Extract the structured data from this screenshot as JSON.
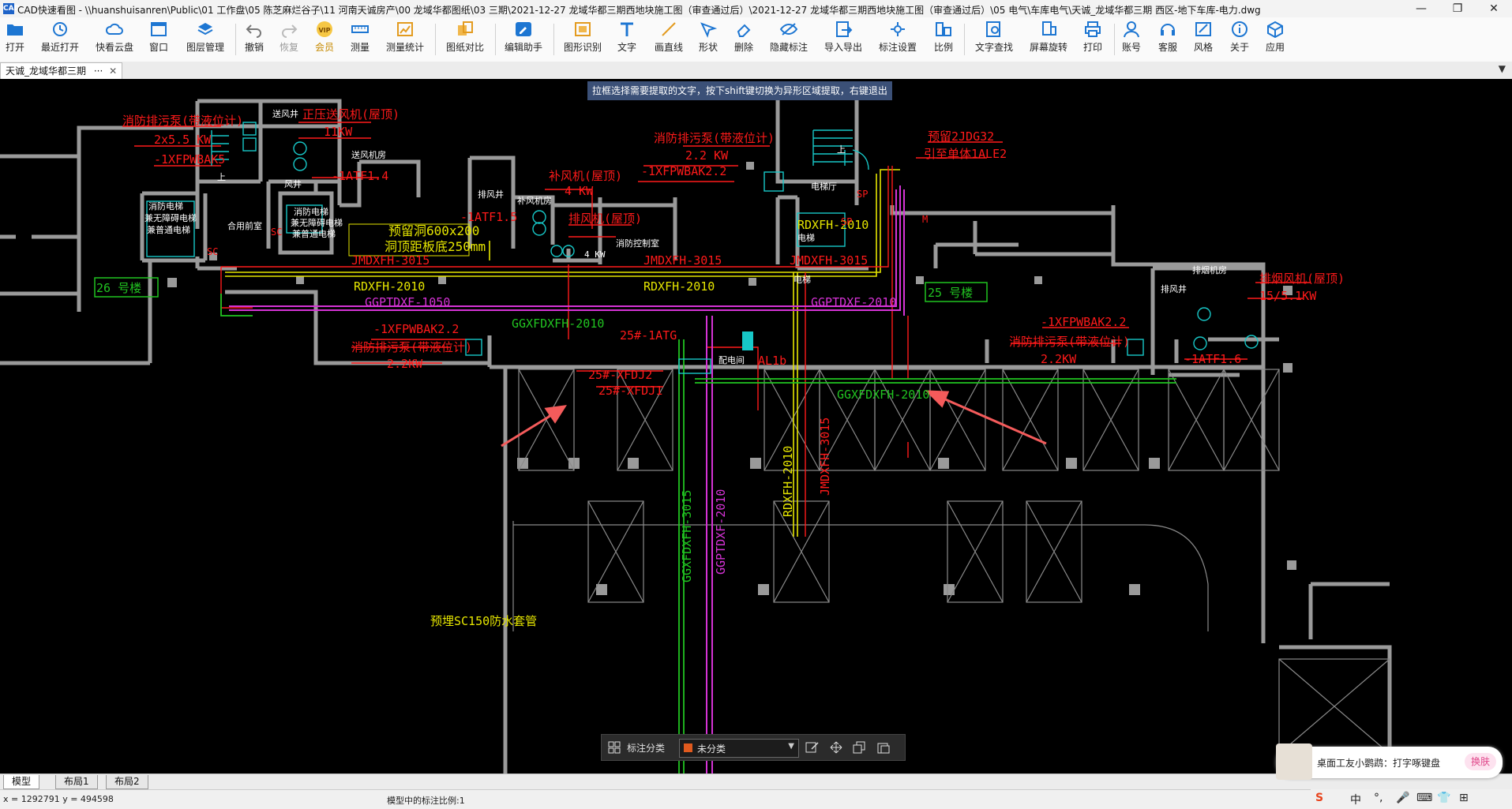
{
  "window": {
    "title": "CAD快速看图 - \\\\huanshuisanren\\Public\\01 工作盘\\05 陈芝麻烂谷子\\11 河南天诚房产\\00 龙域华都图纸\\03 三期\\2021-12-27 龙域华都三期西地块施工图（审查通过后）\\2021-12-27 龙域华都三期西地块施工图（审查通过后）\\05 电气\\车库电气\\天诚_龙域华都三期 西区-地下车库-电力.dwg",
    "app_icon": "CAD",
    "minimize_glyph": "—",
    "maximize_glyph": "❐",
    "close_glyph": "✕"
  },
  "toolbar": {
    "items": [
      {
        "label": "打开",
        "icon": "open-folder-icon"
      },
      {
        "label": "最近打开",
        "icon": "recent-icon"
      },
      {
        "label": "快看云盘",
        "icon": "cloud-icon"
      },
      {
        "label": "窗口",
        "icon": "window-icon"
      },
      {
        "label": "图层管理",
        "icon": "layers-icon"
      },
      {
        "label": "撤销",
        "icon": "undo-icon"
      },
      {
        "label": "恢复",
        "icon": "redo-icon"
      },
      {
        "label": "会员",
        "icon": "vip-icon"
      },
      {
        "label": "测量",
        "icon": "measure-icon"
      },
      {
        "label": "测量统计",
        "icon": "measure-stats-icon"
      },
      {
        "label": "图纸对比",
        "icon": "compare-icon"
      },
      {
        "label": "编辑助手",
        "icon": "edit-assistant-icon"
      },
      {
        "label": "图形识别",
        "icon": "shape-recognize-icon"
      },
      {
        "label": "文字",
        "icon": "text-icon"
      },
      {
        "label": "画直线",
        "icon": "line-icon"
      },
      {
        "label": "形状",
        "icon": "shape-icon"
      },
      {
        "label": "删除",
        "icon": "eraser-icon"
      },
      {
        "label": "隐藏标注",
        "icon": "hide-annotation-icon"
      },
      {
        "label": "导入导出",
        "icon": "import-export-icon"
      },
      {
        "label": "标注设置",
        "icon": "annotation-settings-icon"
      },
      {
        "label": "比例",
        "icon": "scale-icon"
      },
      {
        "label": "文字查找",
        "icon": "text-search-icon"
      },
      {
        "label": "屏幕旋转",
        "icon": "rotate-screen-icon"
      },
      {
        "label": "打印",
        "icon": "print-icon"
      },
      {
        "label": "账号",
        "icon": "account-icon"
      },
      {
        "label": "客服",
        "icon": "headset-icon"
      },
      {
        "label": "风格",
        "icon": "style-icon"
      },
      {
        "label": "关于",
        "icon": "info-icon"
      },
      {
        "label": "应用",
        "icon": "apps-icon"
      }
    ],
    "vip_badge": "VIP"
  },
  "tabs": {
    "doc_tab": "天诚_龙域华都三期",
    "doc_tab_more": "···",
    "doc_tab_close": "✕",
    "dropdown_glyph": "▼"
  },
  "canvas": {
    "hint": "拉框选择需要提取的文字，按下shift键切换为异形区域提取，右键退出",
    "labels": {
      "l1": "消防排污泵(带液位计)",
      "l2": "2x5.5 KW",
      "l3": "-1XFPWBAK5",
      "l4": "正压送风机(屋顶)",
      "l5": "11KW",
      "l6": "送风井",
      "l7": "送风机房",
      "l8": "-1ATF1.4",
      "l9": "风井",
      "l10": "消防电梯",
      "l11": "兼无障碍电梯",
      "l12": "兼普通电梯",
      "l13": "合用前室",
      "l14": "预留洞600x200",
      "l15": "洞顶距板底250mm",
      "l16": "JMDXFH-3015",
      "l17": "RDXFH-2010",
      "l18": "26 号楼",
      "l19": "补风机(屋顶)",
      "l20": "4 KW",
      "l21": "排风机(屋顶)",
      "l22": "-1ATF1.5",
      "l23": "排风井",
      "l24": "补风机房",
      "l25": "消防控制室",
      "l26": "消防排污泵(带液位计)",
      "l27": "2.2 KW",
      "l28": "-1XFPWBAK2.2",
      "l29": "电梯厅",
      "l30": "预留2JDG32",
      "l31": "引至单体1ALE2",
      "l32": "RDXFH-2010",
      "l33": "GGPTDXF-2010",
      "l34": "25 号楼",
      "l35": "GGPTDXF-1050",
      "l36": "GGXFDXFH-2010",
      "l37": "-1XFPWBAK2.2",
      "l38": "消防排污泵(带液位计)",
      "l39": "2.2KW",
      "l40": "25#-1ATG",
      "l41": "25#-XFDJ2",
      "l42": "25#-XFDJ1",
      "l43": "配电间",
      "l44": "AL1b",
      "l45": "GGXFDXFH-2010",
      "l46": "排烟风机(屋顶)",
      "l47": "15/5.1KW",
      "l48": "-1XFPWBAK2.2",
      "l49": "消防排污泵(带液位计)",
      "l50": "2.2KW",
      "l51": "-1ATF1.6",
      "l52": "排烟机房",
      "l53": "RDXFH-2010",
      "l54": "JMDXFH-3015",
      "l55": "GGXFDXFH-3015",
      "l56": "GGPTDXF-2010",
      "l57": "预埋SC150防水套管",
      "l58": "JMDXFH-3015",
      "l59": "JMDXFH-3015",
      "l60": "SP",
      "l61": "SC",
      "l62": "SC",
      "l63": "SP",
      "l64": "M",
      "l65": "上",
      "l66": "上",
      "l67": "电梯",
      "l68": "排风井",
      "l69": "消防电梯",
      "l70": "兼无障碍电梯",
      "l71": "兼普通电梯"
    }
  },
  "bottom_toolbar": {
    "label": "标注分类",
    "select_value": "未分类",
    "select_color": "#e05a1e"
  },
  "layout_tabs": [
    "模型",
    "布局1",
    "布局2"
  ],
  "status": {
    "coords": "x = 1292791  y = 494598",
    "scale": "模型中的标注比例:1"
  },
  "popup": {
    "text": "桌面工友小鹦鹉：打字啄键盘",
    "button": "换肤"
  },
  "ime": {
    "lang": "中",
    "items": [
      "S",
      "中",
      "°,",
      "🎤",
      "⌨",
      "👕",
      "⊞"
    ]
  },
  "colors": {
    "cad_red": "#ff1a1a",
    "cad_yellow": "#e6e600",
    "cad_green": "#21c421",
    "cad_magenta": "#d633d6",
    "cad_cyan": "#17c8c8",
    "wall_gray": "#9a9a9a"
  }
}
